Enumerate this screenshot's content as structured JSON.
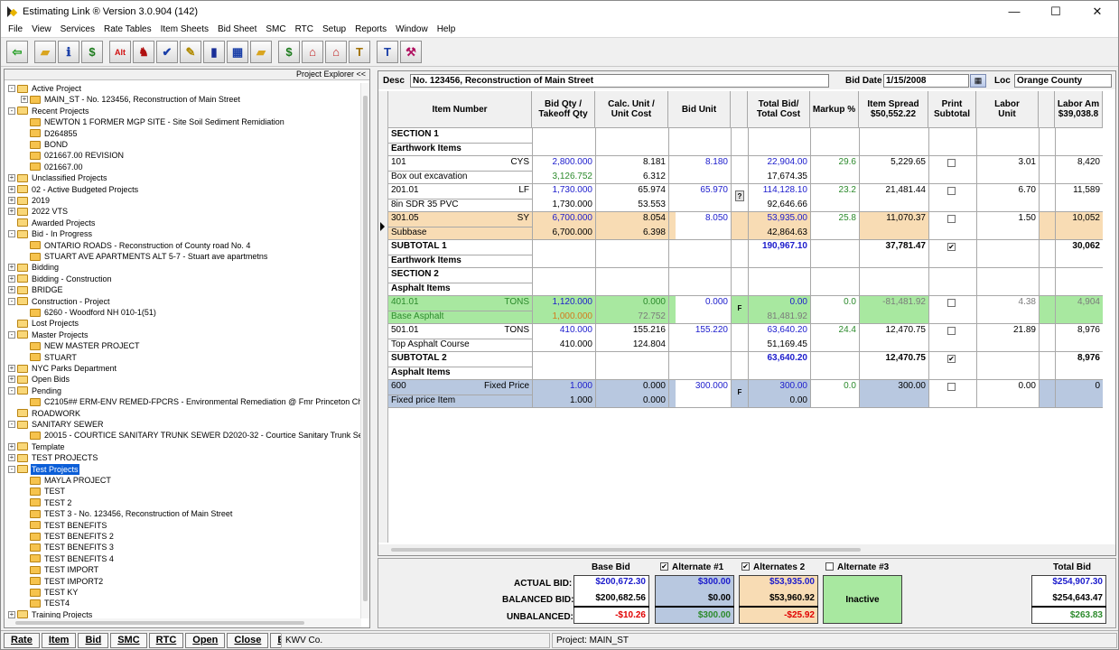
{
  "window": {
    "title": "Estimating Link ® Version  3.0.904 (142)",
    "min_icon": "minimize-icon",
    "max_icon": "maximize-icon",
    "close_icon": "close-icon"
  },
  "menu": [
    "File",
    "View",
    "Services",
    "Rate Tables",
    "Item Sheets",
    "Bid Sheet",
    "SMC",
    "RTC",
    "Setup",
    "Reports",
    "Window",
    "Help"
  ],
  "toolbar": [
    {
      "name": "back-arrow-icon",
      "glyph": "⇦",
      "color": "#1a9a1a"
    },
    {
      "name": "open-folder-icon",
      "glyph": "▰",
      "color": "#d9a520"
    },
    {
      "name": "info-icon",
      "glyph": "ℹ",
      "color": "#1a3fa8"
    },
    {
      "name": "dollar-arrows-icon",
      "glyph": "$",
      "color": "#1a7a1a"
    },
    {
      "name": "alt-icon",
      "glyph": "Alt",
      "color": "#d01010"
    },
    {
      "name": "person-chart-icon",
      "glyph": "♞",
      "color": "#b01010"
    },
    {
      "name": "checklist-icon",
      "glyph": "✔",
      "color": "#1a3fa8"
    },
    {
      "name": "notepad-pencil-icon",
      "glyph": "✎",
      "color": "#b08a00"
    },
    {
      "name": "book-icon",
      "glyph": "▮",
      "color": "#1a2f98"
    },
    {
      "name": "grid-sheet-icon",
      "glyph": "▦",
      "color": "#1a3fa8"
    },
    {
      "name": "folders-icon",
      "glyph": "▰",
      "color": "#d9a520"
    },
    {
      "name": "dollar-folder-icon",
      "glyph": "$",
      "color": "#1a7a1a"
    },
    {
      "name": "building-icon",
      "glyph": "⌂",
      "color": "#c02020"
    },
    {
      "name": "building-alt-icon",
      "glyph": "⌂",
      "color": "#c02020"
    },
    {
      "name": "hammer-icon",
      "glyph": "T",
      "color": "#a07000"
    },
    {
      "name": "hammer-blue-icon",
      "glyph": "T",
      "color": "#1a3fa8"
    },
    {
      "name": "tools-people-icon",
      "glyph": "⚒",
      "color": "#b01060"
    }
  ],
  "explorer": {
    "header": "Project Explorer <<",
    "nodes": [
      {
        "t": "Active Project",
        "l": 0,
        "e": "-",
        "f": 1
      },
      {
        "t": "MAIN_ST - No. 123456, Reconstruction of Main Street",
        "l": 1,
        "e": "+",
        "f": 0
      },
      {
        "t": "Recent Projects",
        "l": 0,
        "e": "-",
        "f": 1
      },
      {
        "t": "NEWTON 1 FORMER MGP SITE - Site Soil  Sediment Remidiation",
        "l": 1,
        "e": "",
        "f": 0
      },
      {
        "t": "D264855",
        "l": 1,
        "e": "",
        "f": 0
      },
      {
        "t": "BOND",
        "l": 1,
        "e": "",
        "f": 0
      },
      {
        "t": "021667.00 REVISION",
        "l": 1,
        "e": "",
        "f": 0
      },
      {
        "t": "021667.00",
        "l": 1,
        "e": "",
        "f": 0
      },
      {
        "t": "Unclassified Projects",
        "l": 0,
        "e": "+",
        "f": 1
      },
      {
        "t": "02 - Active Budgeted Projects",
        "l": 0,
        "e": "+",
        "f": 1
      },
      {
        "t": "2019",
        "l": 0,
        "e": "+",
        "f": 1
      },
      {
        "t": "2022 VTS",
        "l": 0,
        "e": "+",
        "f": 1
      },
      {
        "t": "Awarded Projects",
        "l": 0,
        "e": "",
        "f": 1
      },
      {
        "t": "Bid - In Progress",
        "l": 0,
        "e": "-",
        "f": 1
      },
      {
        "t": "ONTARIO ROADS - Reconstruction of County road No. 4",
        "l": 1,
        "e": "",
        "f": 0
      },
      {
        "t": "STUART AVE APARTMENTS ALT 5-7 - Stuart ave apartmetns",
        "l": 1,
        "e": "",
        "f": 0
      },
      {
        "t": "Bidding",
        "l": 0,
        "e": "+",
        "f": 1
      },
      {
        "t": "Bidding - Construction",
        "l": 0,
        "e": "+",
        "f": 1
      },
      {
        "t": "BRIDGE",
        "l": 0,
        "e": "+",
        "f": 1
      },
      {
        "t": "Construction - Project",
        "l": 0,
        "e": "-",
        "f": 1
      },
      {
        "t": "6260 - Woodford NH 010-1(51)",
        "l": 1,
        "e": "",
        "f": 0
      },
      {
        "t": "Lost Projects",
        "l": 0,
        "e": "",
        "f": 1
      },
      {
        "t": "Master Projects",
        "l": 0,
        "e": "-",
        "f": 1
      },
      {
        "t": "NEW MASTER PROJECT",
        "l": 1,
        "e": "",
        "f": 0
      },
      {
        "t": "STUART",
        "l": 1,
        "e": "",
        "f": 0
      },
      {
        "t": "NYC Parks Department",
        "l": 0,
        "e": "+",
        "f": 1
      },
      {
        "t": "Open Bids",
        "l": 0,
        "e": "+",
        "f": 1
      },
      {
        "t": "Pending",
        "l": 0,
        "e": "-",
        "f": 1
      },
      {
        "t": "C2105## ERM-ENV REMED-FPCRS - Environmental Remediation @ Fmr Princeton Chemical",
        "l": 1,
        "e": "",
        "f": 0
      },
      {
        "t": "ROADWORK",
        "l": 0,
        "e": "",
        "f": 1
      },
      {
        "t": "SANITARY SEWER",
        "l": 0,
        "e": "-",
        "f": 1
      },
      {
        "t": "20015 - COURTICE SANITARY TRUNK SEWER D2020-32 - Courtice Sanitary Trunk Sewer",
        "l": 1,
        "e": "",
        "f": 0
      },
      {
        "t": "Template",
        "l": 0,
        "e": "+",
        "f": 1
      },
      {
        "t": "TEST PROJECTS",
        "l": 0,
        "e": "+",
        "f": 1
      },
      {
        "t": "Test Projects",
        "l": 0,
        "e": "-",
        "f": 1,
        "sel": true
      },
      {
        "t": "MAYLA PROJECT",
        "l": 1,
        "e": "",
        "f": 0
      },
      {
        "t": "TEST",
        "l": 1,
        "e": "",
        "f": 0
      },
      {
        "t": "TEST 2",
        "l": 1,
        "e": "",
        "f": 0
      },
      {
        "t": "TEST 3 - No. 123456, Reconstruction of Main Street",
        "l": 1,
        "e": "",
        "f": 0
      },
      {
        "t": "TEST BENEFITS",
        "l": 1,
        "e": "",
        "f": 0
      },
      {
        "t": "TEST BENEFITS 2",
        "l": 1,
        "e": "",
        "f": 0
      },
      {
        "t": "TEST BENEFITS 3",
        "l": 1,
        "e": "",
        "f": 0
      },
      {
        "t": "TEST BENEFITS 4",
        "l": 1,
        "e": "",
        "f": 0
      },
      {
        "t": "TEST IMPORT",
        "l": 1,
        "e": "",
        "f": 0
      },
      {
        "t": "TEST IMPORT2",
        "l": 1,
        "e": "",
        "f": 0
      },
      {
        "t": "TEST KY",
        "l": 1,
        "e": "",
        "f": 0
      },
      {
        "t": "TEST4",
        "l": 1,
        "e": "",
        "f": 0
      },
      {
        "t": "Training Projects",
        "l": 0,
        "e": "+",
        "f": 1
      }
    ]
  },
  "desc": {
    "label": "Desc",
    "value": "No. 123456, Reconstruction of Main Street",
    "bid_date_label": "Bid Date",
    "bid_date": "1/15/2008",
    "loc_label": "Loc",
    "loc": "Orange County"
  },
  "columns": [
    "Item Number",
    "Bid Qty /\nTakeoff Qty",
    "Calc. Unit /\nUnit Cost",
    "Bid Unit",
    "",
    "Total Bid/\nTotal Cost",
    "Markup %",
    "Item Spread\n$50,552.22",
    "Print\nSubtotal",
    "Labor\nUnit",
    "",
    "Labor Am\n$39,038.8"
  ],
  "rows": [
    {
      "kind": "section",
      "a": "SECTION 1",
      "b": "Earthwork Items"
    },
    {
      "kind": "item",
      "num": "101",
      "unit": "CYS",
      "desc": "Box out excavation",
      "q1": "2,800.000",
      "q2": "3,126.752",
      "q2c": "green",
      "c1": "8.181",
      "c2": "6.312",
      "bu": "8.180",
      "flag": "",
      "t1": "22,904.00",
      "t2": "17,674.35",
      "mk": "29.6",
      "sp": "5,229.65",
      "ck": false,
      "lu": "3.01",
      "la": "8,420",
      "bg": ""
    },
    {
      "kind": "item",
      "num": "201.01",
      "unit": "LF",
      "desc": "8in SDR 35 PVC",
      "q1": "1,730.000",
      "q2": "1,730.000",
      "q2c": "",
      "c1": "65.974",
      "c2": "53.553",
      "bu": "65.970",
      "flag": "?",
      "t1": "114,128.10",
      "t2": "92,646.66",
      "mk": "23.2",
      "sp": "21,481.44",
      "ck": false,
      "lu": "6.70",
      "la": "11,589",
      "bg": ""
    },
    {
      "kind": "item",
      "num": "301.05",
      "unit": "SY",
      "desc": "Subbase",
      "q1": "6,700.000",
      "q2": "6,700.000",
      "q2c": "",
      "c1": "8.054",
      "c2": "6.398",
      "bu": "8.050",
      "flag": "",
      "t1": "53,935.00",
      "t2": "42,864.63",
      "mk": "25.8",
      "sp": "11,070.37",
      "ck": false,
      "lu": "1.50",
      "la": "10,052",
      "bg": "orange"
    },
    {
      "kind": "subtotal",
      "a": "SUBTOTAL 1",
      "b": "Earthwork Items",
      "t1": "190,967.10",
      "sp": "37,781.47",
      "ck": true,
      "la": "30,062"
    },
    {
      "kind": "section",
      "a": "SECTION 2",
      "b": "Asphalt Items"
    },
    {
      "kind": "item",
      "num": "401.01",
      "unit": "TONS",
      "desc": "Base Asphalt",
      "q1": "1,120.000",
      "q2": "1,000.000",
      "q2c": "orange",
      "c1": "0.000",
      "c2": "72.752",
      "bu": "0.000",
      "flag": "F",
      "t1": "0.00",
      "t2": "81,481.92",
      "mk": "0.0",
      "sp": "-81,481.92",
      "ck": false,
      "lu": "4.38",
      "la": "4,904",
      "bg": "green"
    },
    {
      "kind": "item",
      "num": "501.01",
      "unit": "TONS",
      "desc": "Top Asphalt Course",
      "q1": "410.000",
      "q2": "410.000",
      "q2c": "",
      "c1": "155.216",
      "c2": "124.804",
      "bu": "155.220",
      "flag": "",
      "t1": "63,640.20",
      "t2": "51,169.45",
      "mk": "24.4",
      "sp": "12,470.75",
      "ck": false,
      "lu": "21.89",
      "la": "8,976",
      "bg": ""
    },
    {
      "kind": "subtotal",
      "a": "SUBTOTAL 2",
      "b": "Asphalt Items",
      "t1": "63,640.20",
      "sp": "12,470.75",
      "ck": true,
      "la": "8,976"
    },
    {
      "kind": "item",
      "num": "600",
      "unit": "Fixed Price",
      "desc": "Fixed price Item",
      "q1": "1.000",
      "q2": "1.000",
      "q2c": "",
      "c1": "0.000",
      "c2": "0.000",
      "bu": "300.000",
      "flag": "F",
      "t1": "300.00",
      "t2": "0.00",
      "mk": "0.0",
      "sp": "300.00",
      "ck": false,
      "lu": "0.00",
      "la": "0",
      "bg": "blue"
    }
  ],
  "totals": {
    "base_bid_label": "Base Bid",
    "alt1_label": "Alternate #1",
    "alt2_label": "Alternates 2",
    "alt3_label": "Alternate #3",
    "total_label": "Total Bid",
    "actual_label": "ACTUAL BID:",
    "balanced_label": "BALANCED BID:",
    "unbalanced_label": "UNBALANCED:",
    "base": {
      "actual": "$200,672.30",
      "balanced": "$200,682.56",
      "unbalanced": "-$10.26"
    },
    "alt1": {
      "actual": "$300.00",
      "balanced": "$0.00",
      "unbalanced": "$300.00"
    },
    "alt2": {
      "actual": "$53,935.00",
      "balanced": "$53,960.92",
      "unbalanced": "-$25.92"
    },
    "alt3": {
      "status": "Inactive"
    },
    "total": {
      "actual": "$254,907.30",
      "balanced": "$254,643.47",
      "unbalanced": "$263.83"
    },
    "alt1_checked": true,
    "alt2_checked": true,
    "alt3_checked": false
  },
  "bottom": {
    "buttons": [
      "Rate",
      "Item",
      "Bid",
      "SMC",
      "RTC",
      "Open",
      "Close",
      "Exit"
    ],
    "company": "KWV Co.",
    "project": "Project: MAIN_ST"
  },
  "colors": {
    "orange_row": "#f8dcb4",
    "green_row": "#a8e8a0",
    "blue_row": "#b8c8e0",
    "selected": "#0b5ed7"
  }
}
